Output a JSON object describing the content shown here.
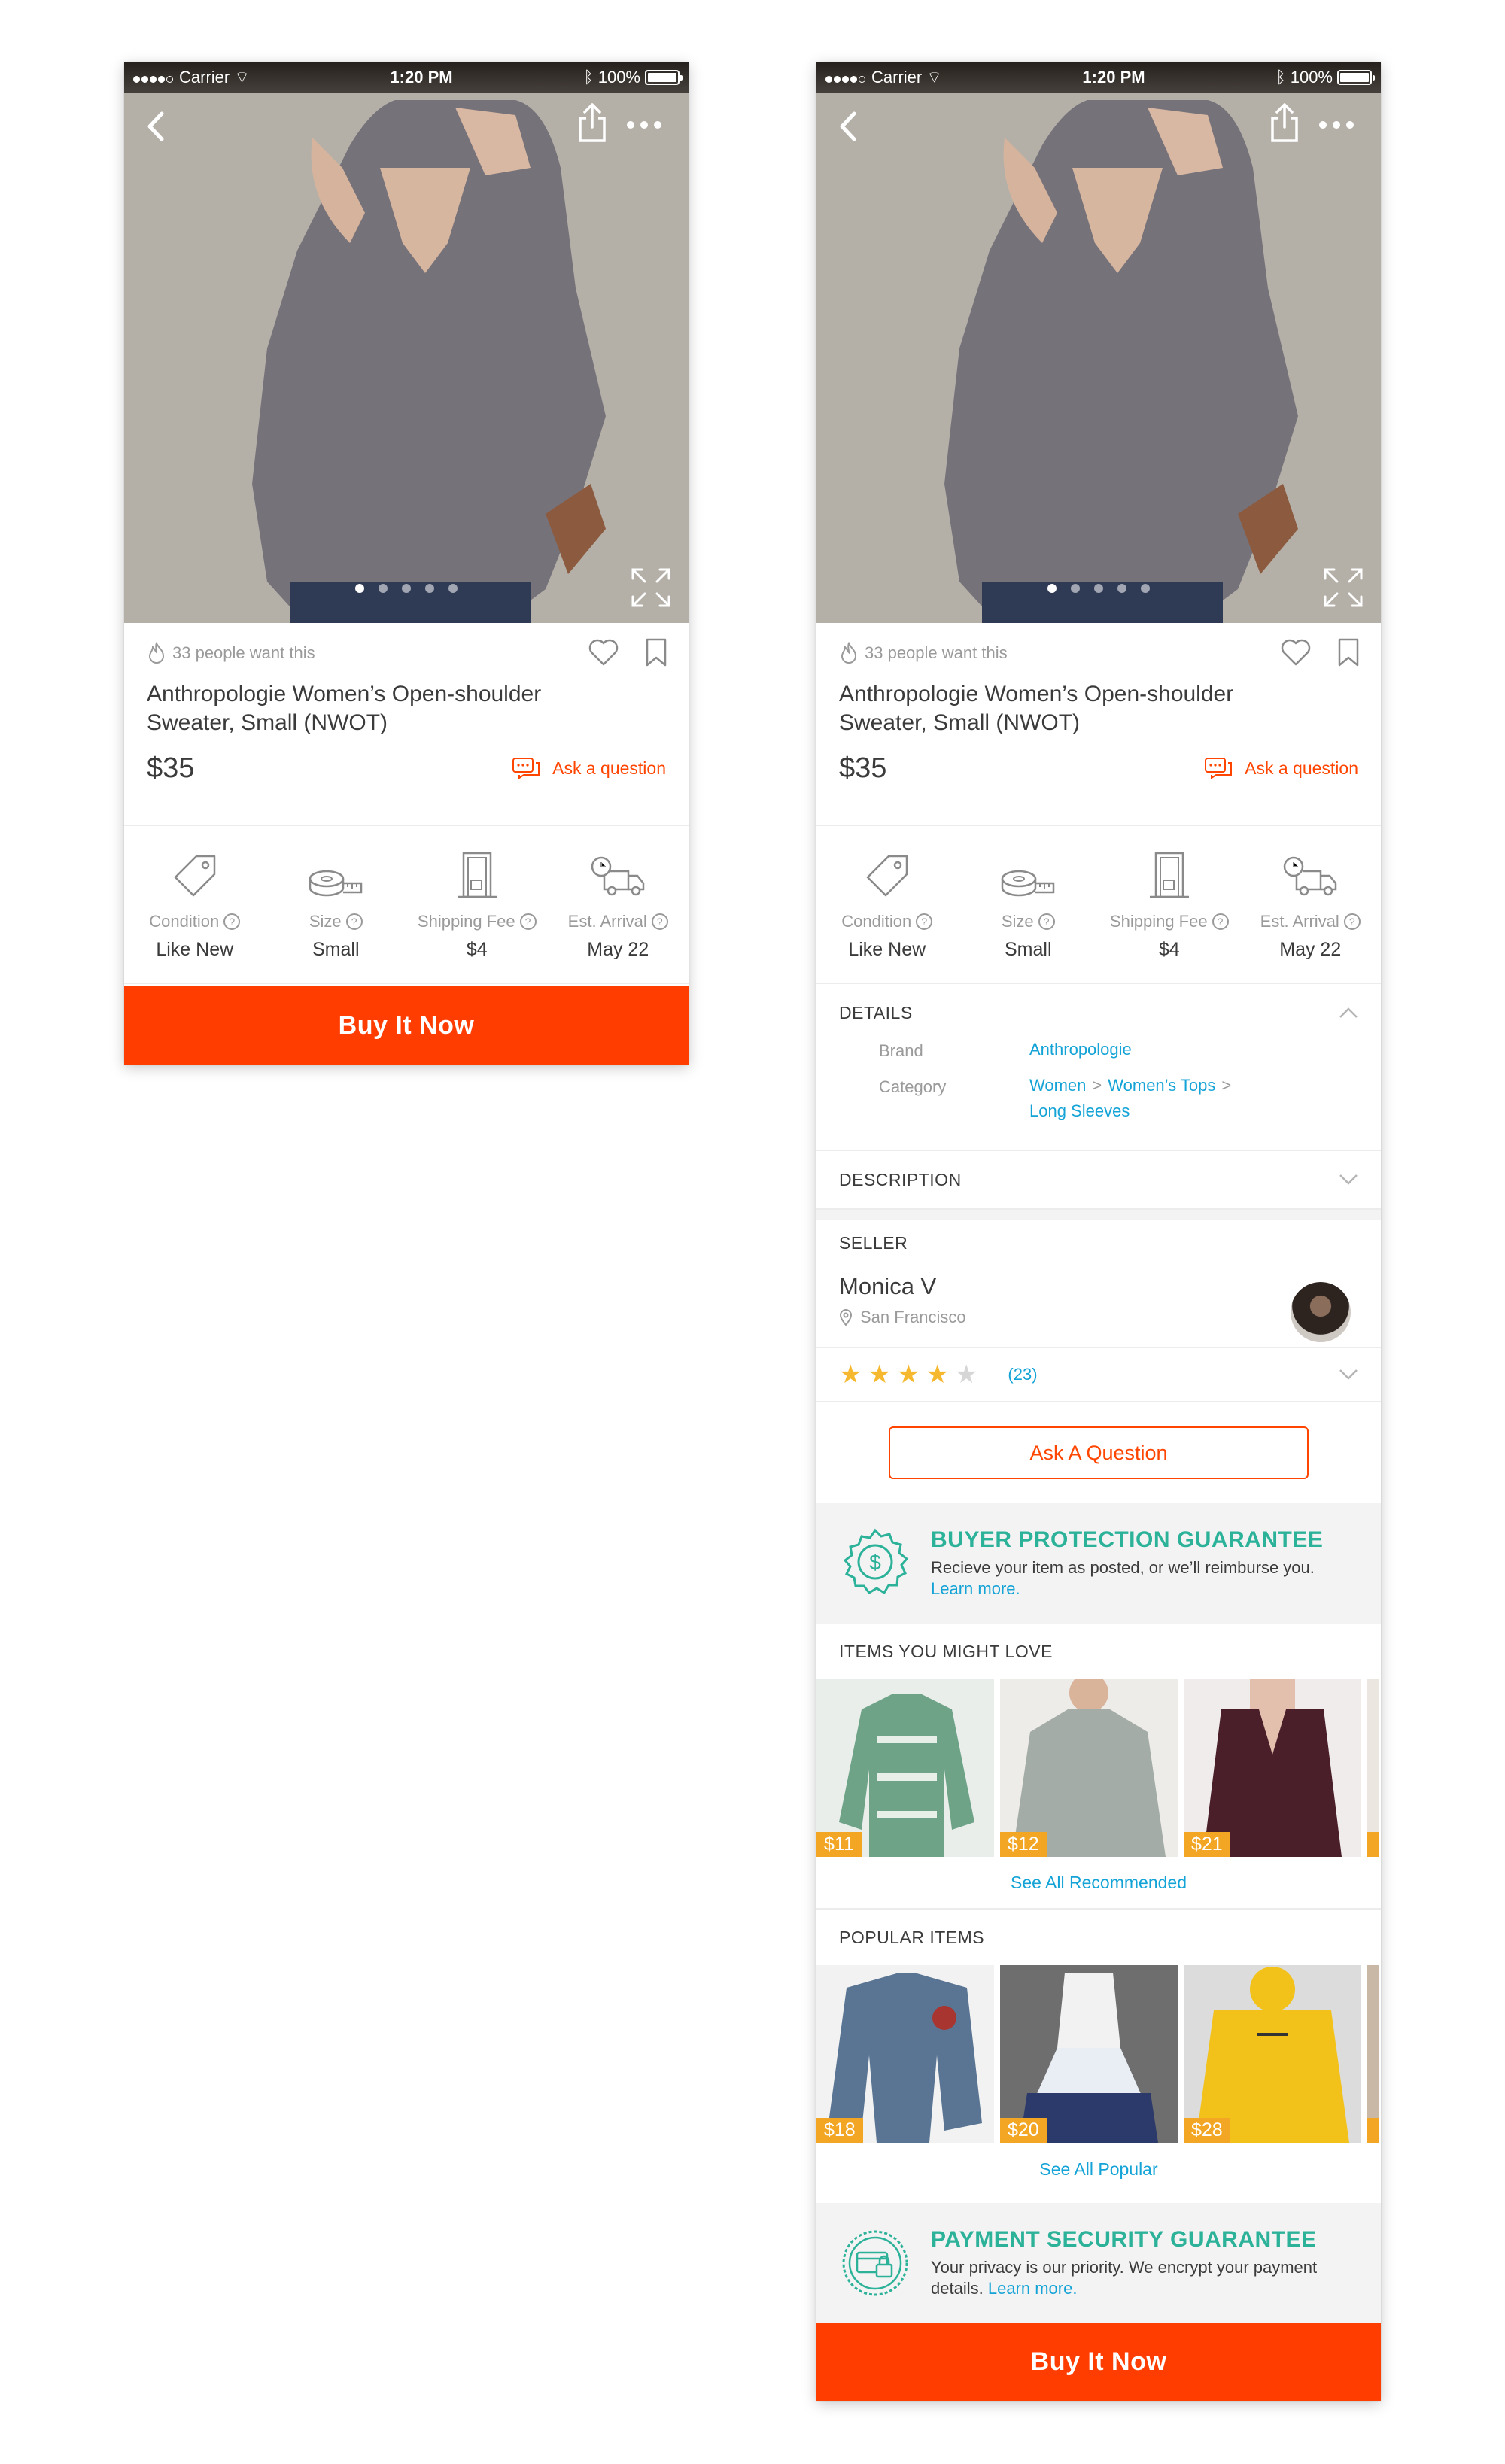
{
  "status_bar": {
    "carrier": "Carrier",
    "time": "1:20 PM",
    "battery": "100%"
  },
  "listing": {
    "want_count_text": "33 people want this",
    "title": "Anthropologie Women’s Open-shoulder Sweater, Small (NWOT)",
    "price": "$35",
    "ask_link": "Ask a question",
    "image_pager": {
      "total": 5,
      "current": 1
    }
  },
  "specs": [
    {
      "label": "Condition",
      "value": "Like New",
      "icon": "tag-icon"
    },
    {
      "label": "Size",
      "value": "Small",
      "icon": "tape-measure-icon"
    },
    {
      "label": "Shipping Fee",
      "value": "$4",
      "icon": "door-icon"
    },
    {
      "label": "Est. Arrival",
      "value": "May 22",
      "icon": "delivery-truck-icon"
    }
  ],
  "buy_button": "Buy It Now",
  "details": {
    "heading": "DETAILS",
    "brand_label": "Brand",
    "brand_value": "Anthropologie",
    "category_label": "Category",
    "category_path": [
      "Women",
      "Women’s Tops",
      "Long Sleeves"
    ],
    "separator": ">"
  },
  "description": {
    "heading": "DESCRIPTION"
  },
  "seller": {
    "heading": "SELLER",
    "name": "Monica V",
    "location": "San Francisco",
    "rating": 4,
    "rating_max": 5,
    "review_count": "(23)"
  },
  "ask_button": "Ask A Question",
  "buyer_protection": {
    "title": "BUYER PROTECTION GUARANTEE",
    "text": "Recieve your item as posted, or we’ll reimburse you.",
    "link": "Learn more."
  },
  "recommended": {
    "heading": "ITEMS YOU MIGHT LOVE",
    "items": [
      {
        "price": "$11",
        "color": "#6fa388"
      },
      {
        "price": "$12",
        "color": "#a3aca7"
      },
      {
        "price": "$21",
        "color": "#4a1f2a"
      }
    ],
    "see_all": "See All Recommended"
  },
  "popular": {
    "heading": "POPULAR ITEMS",
    "items": [
      {
        "price": "$18",
        "color": "#5a7593"
      },
      {
        "price": "$20",
        "color": "#2c3a6b"
      },
      {
        "price": "$28",
        "color": "#f2c21b"
      }
    ],
    "see_all": "See All Popular"
  },
  "payment_security": {
    "title": "PAYMENT SECURITY GUARANTEE",
    "text": "Your privacy is our priority. We encrypt your payment details.",
    "link": "Learn more."
  },
  "colors": {
    "accent": "#ff3d00",
    "link": "#13a3d6",
    "guarantee": "#2db29a",
    "price_tag": "#f2a623"
  }
}
